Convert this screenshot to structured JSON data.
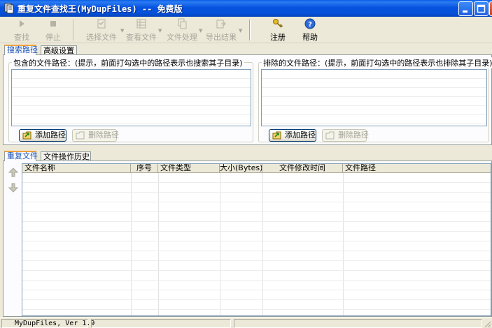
{
  "window": {
    "title": "重复文件查找王(MyDupFiles) -- 免费版"
  },
  "toolbar": {
    "items": [
      {
        "label": "查找",
        "icon": "play-icon",
        "enabled": false
      },
      {
        "label": "停止",
        "icon": "stop-icon",
        "enabled": false
      },
      {
        "label": "选择文件",
        "icon": "select-files-icon",
        "enabled": false,
        "dropdown": true
      },
      {
        "label": "查看文件",
        "icon": "view-file-icon",
        "enabled": false,
        "dropdown": true
      },
      {
        "label": "文件处理",
        "icon": "file-process-icon",
        "enabled": false,
        "dropdown": true
      },
      {
        "label": "导出结果",
        "icon": "export-icon",
        "enabled": false,
        "dropdown": true
      },
      {
        "label": "注册",
        "icon": "key-icon",
        "enabled": true
      },
      {
        "label": "帮助",
        "icon": "help-icon",
        "enabled": true
      }
    ]
  },
  "top_tabs": [
    {
      "label": "搜索路径",
      "active": true
    },
    {
      "label": "高级设置",
      "active": false
    }
  ],
  "included": {
    "title": "包含的文件路径：(提示，前面打勾选中的路径表示也搜索其子目录)",
    "add_label": "添加路径",
    "delete_label": "删除路径"
  },
  "excluded": {
    "title": "排除的文件路径：(提示，前面打勾选中的路径表示也排除其子目录)",
    "add_label": "添加路径",
    "delete_label": "删除路径"
  },
  "bottom_tabs": [
    {
      "label": "重复文件",
      "active": true
    },
    {
      "label": "文件操作历史",
      "active": false
    }
  ],
  "results": {
    "columns": [
      "文件名称",
      "序号",
      "文件类型",
      "大小(Bytes)",
      "文件修改时间",
      "文件路径"
    ]
  },
  "statusbar": {
    "version": "MyDupFiles, Ver 1.9"
  }
}
